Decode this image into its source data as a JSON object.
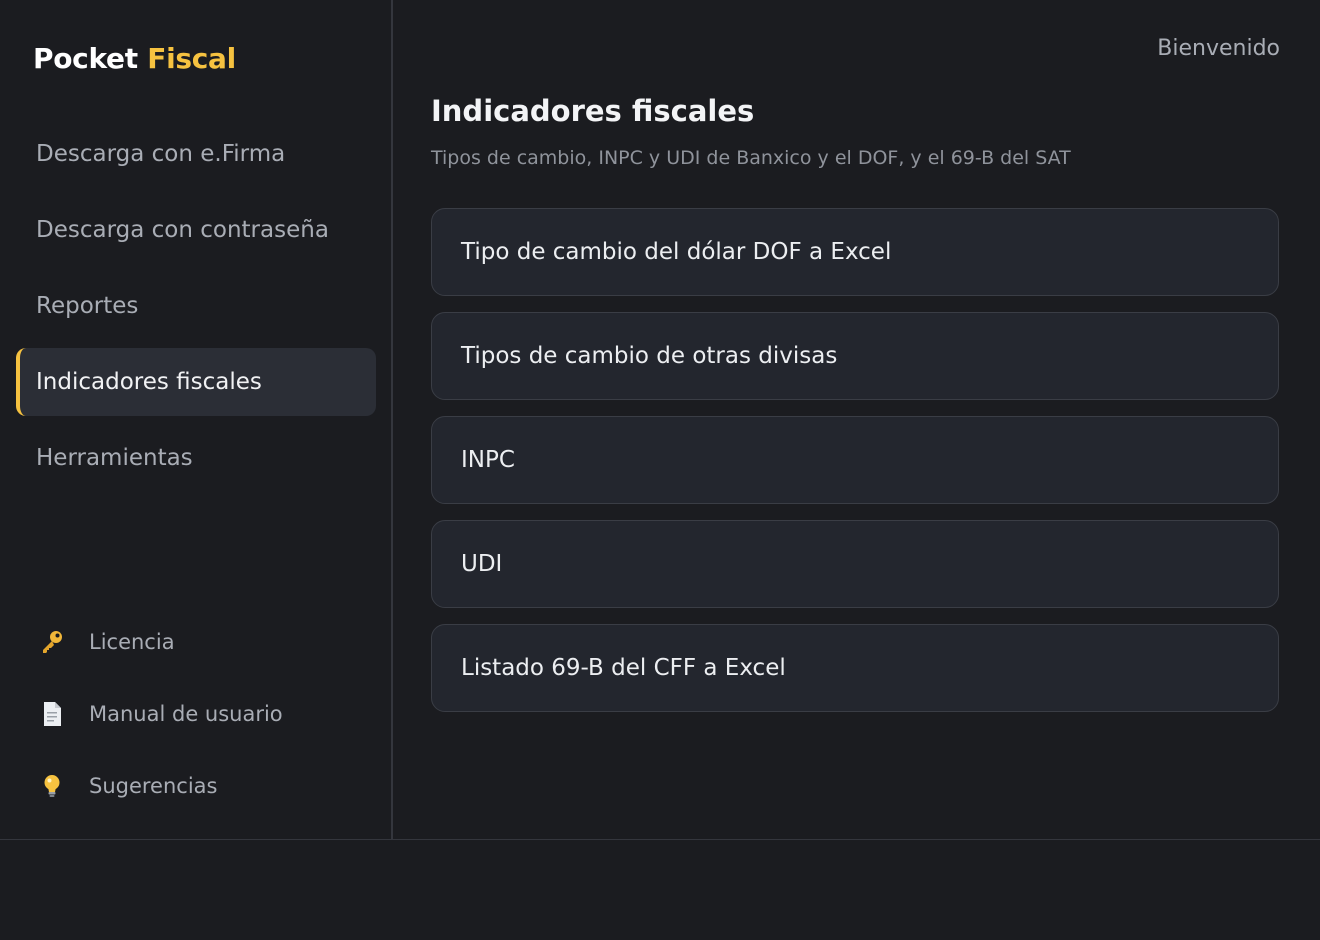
{
  "brand": {
    "part1": "Pocket",
    "part2": "Fiscal",
    "accent_color": "#f6c240"
  },
  "sidebar": {
    "items": [
      {
        "label": "Descarga con e.Firma"
      },
      {
        "label": "Descarga con contraseña"
      },
      {
        "label": "Reportes"
      },
      {
        "label": "Indicadores fiscales",
        "active": true
      },
      {
        "label": "Herramientas"
      }
    ],
    "utilities": [
      {
        "label": "Licencia",
        "icon": "key-icon"
      },
      {
        "label": "Manual de usuario",
        "icon": "document-icon"
      },
      {
        "label": "Sugerencias",
        "icon": "lightbulb-icon"
      }
    ]
  },
  "header": {
    "welcome": "Bienvenido"
  },
  "main": {
    "title": "Indicadores fiscales",
    "subtitle": "Tipos de cambio, INPC y UDI de Banxico y el DOF, y el 69-B del SAT",
    "cards": [
      {
        "label": "Tipo de cambio del dólar DOF a Excel"
      },
      {
        "label": "Tipos de cambio de otras divisas"
      },
      {
        "label": "INPC"
      },
      {
        "label": "UDI"
      },
      {
        "label": "Listado 69-B del CFF a Excel"
      }
    ]
  }
}
